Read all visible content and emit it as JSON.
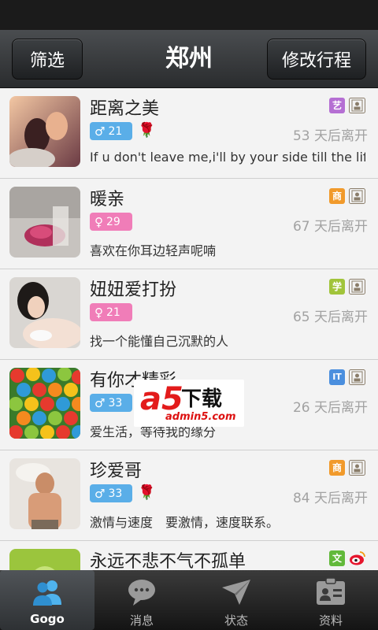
{
  "header": {
    "filter_label": "筛选",
    "city": "郑州",
    "edit_trip_label": "修改行程"
  },
  "users": [
    {
      "name": "距离之美",
      "tag": "艺",
      "tag_color": "#b56fd3",
      "gender": "male",
      "age": "21",
      "rose": true,
      "leave": "53 天后离开",
      "signature": "If u don't leave me,i'll by your side till the lif."
    },
    {
      "name": "暖亲",
      "tag": "商",
      "tag_color": "#f19a2b",
      "gender": "female",
      "age": "29",
      "rose": false,
      "leave": "67 天后离开",
      "signature": "喜欢在你耳边轻声呢喃"
    },
    {
      "name": "妞妞爱打扮",
      "tag": "学",
      "tag_color": "#a1c43a",
      "gender": "female",
      "age": "21",
      "rose": false,
      "leave": "65 天后离开",
      "signature": "找一个能懂自己沉默的人"
    },
    {
      "name": "有你才精彩",
      "tag": "IT",
      "tag_color": "#4b8fde",
      "gender": "male",
      "age": "33",
      "rose": true,
      "leave": "26 天后离开",
      "signature": "爱生活，等待我的缘分"
    },
    {
      "name": "珍爱哥",
      "tag": "商",
      "tag_color": "#f19a2b",
      "gender": "male",
      "age": "33",
      "rose": true,
      "leave": "84 天后离开",
      "signature": "激情与速度　要激情，速度联系。"
    },
    {
      "name": "永远不悲不气不孤单",
      "tag": "文",
      "tag_color": "#62b93a",
      "gender": "male",
      "age": "",
      "rose": false,
      "leave": "",
      "signature": ""
    }
  ],
  "watermark": {
    "brand": "a5",
    "cn": "下载",
    "url": "admin5.com"
  },
  "tabs": [
    {
      "label": "Gogo",
      "icon": "people-icon",
      "active": true
    },
    {
      "label": "消息",
      "icon": "chat-bubble-icon",
      "active": false
    },
    {
      "label": "状态",
      "icon": "paper-plane-icon",
      "active": false
    },
    {
      "label": "资料",
      "icon": "id-card-icon",
      "active": false
    }
  ]
}
